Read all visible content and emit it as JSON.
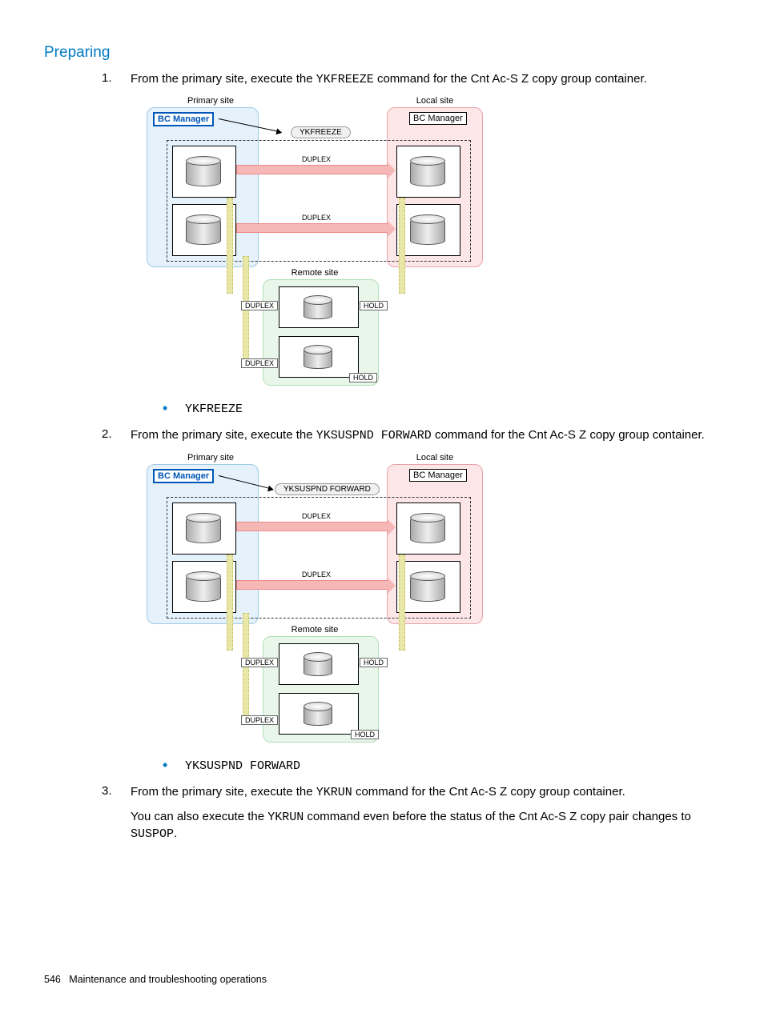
{
  "heading": "Preparing",
  "steps": [
    {
      "index": "1",
      "text_prefix": "From the primary site, execute the ",
      "cmd": "YKFREEZE",
      "text_suffix": " command for the Cnt Ac-S Z copy group container.",
      "bullet_cmd": "YKFREEZE",
      "figure": {
        "primary_label": "Primary site",
        "local_label": "Local site",
        "remote_label": "Remote site",
        "bc_primary": "BC Manager",
        "bc_local": "BC Manager",
        "cmd_pill": "YKFREEZE",
        "duplex1": "DUPLEX",
        "duplex2": "DUPLEX",
        "r_duplex1": "DUPLEX",
        "r_duplex2": "DUPLEX",
        "r_hold1": "HOLD",
        "r_hold2": "HOLD"
      }
    },
    {
      "index": "2",
      "text_prefix": "From the primary site, execute the ",
      "cmd": "YKSUSPND FORWARD",
      "text_suffix": " command for the Cnt Ac-S Z copy group container.",
      "bullet_cmd": "YKSUSPND FORWARD",
      "figure": {
        "primary_label": "Primary site",
        "local_label": "Local site",
        "remote_label": "Remote site",
        "bc_primary": "BC Manager",
        "bc_local": "BC Manager",
        "cmd_pill": "YKSUSPND FORWARD",
        "duplex1": "DUPLEX",
        "duplex2": "DUPLEX",
        "r_duplex1": "DUPLEX",
        "r_duplex2": "DUPLEX",
        "r_hold1": "HOLD",
        "r_hold2": "HOLD"
      }
    },
    {
      "index": "3",
      "text_prefix": "From the primary site, execute the ",
      "cmd": "YKRUN",
      "text_suffix": " command for the Cnt Ac-S Z copy group container.",
      "note_prefix": "You can also execute the ",
      "note_cmd": "YKRUN",
      "note_mid": " command even before the status of the Cnt Ac-S Z copy pair changes to ",
      "note_status": "SUSPOP",
      "note_end": "."
    }
  ],
  "footer": {
    "page": "546",
    "chapter": "Maintenance and troubleshooting operations"
  }
}
